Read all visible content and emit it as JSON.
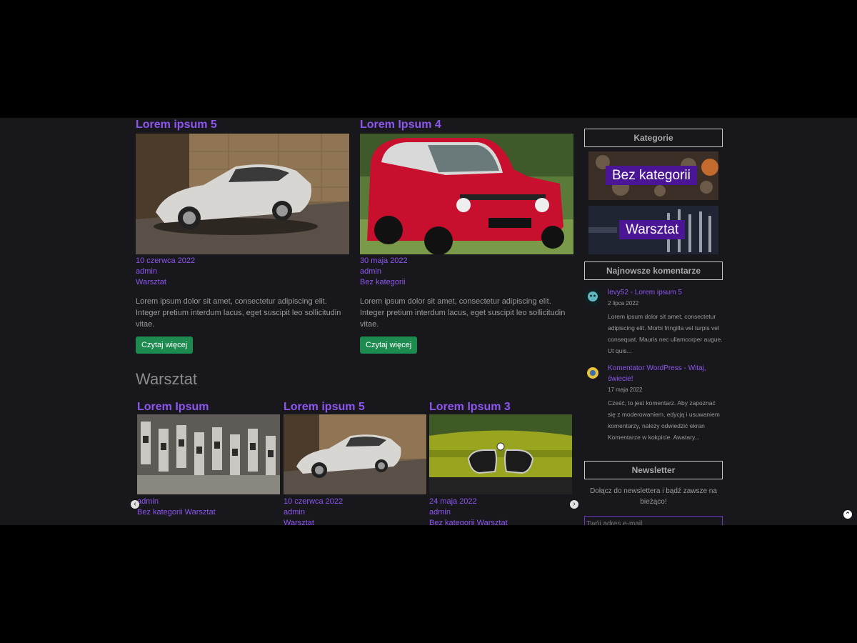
{
  "featured_posts": [
    {
      "title": "Lorem ipsum 5",
      "date": "10 czerwca 2022",
      "author": "admin",
      "category": "Warsztat",
      "excerpt": "Lorem ipsum dolor sit amet, consectetur adipiscing elit. Integer pretium interdum lacus, eget suscipit leo sollicitudin vitae.",
      "button": "Czytaj więcej",
      "image_icon": "white-sports-car-image"
    },
    {
      "title": "Lorem Ipsum 4",
      "date": "30 maja 2022",
      "author": "admin",
      "category": "Bez kategorii",
      "excerpt": "Lorem ipsum dolor sit amet, consectetur adipiscing elit. Integer pretium interdum lacus, eget suscipit leo sollicitudin vitae.",
      "button": "Czytaj więcej",
      "image_icon": "red-small-car-image"
    }
  ],
  "section": {
    "heading": "Warsztat",
    "cards": [
      {
        "title": "Lorem Ipsum",
        "meta1": "admin",
        "meta2": "Bez kategorii Warsztat",
        "meta3": "",
        "image_icon": "engine-valves-image"
      },
      {
        "title": "Lorem ipsum 5",
        "meta1": "10 czerwca 2022",
        "meta2": "admin",
        "meta3": "Warsztat",
        "image_icon": "white-sports-car-image"
      },
      {
        "title": "Lorem Ipsum 3",
        "meta1": "24 maja 2022",
        "meta2": "admin",
        "meta3": "Bez kategorii Warsztat",
        "image_icon": "green-bmw-image"
      }
    ],
    "prev_icon": "chevron-left-icon",
    "next_icon": "chevron-right-icon"
  },
  "sidebar": {
    "categories_title": "Kategorie",
    "categories": [
      "Bez kategorii",
      "Warsztat"
    ],
    "comments_title": "Najnowsze komentarze",
    "comments": [
      {
        "head": "levy52 - Lorem ipsum 5",
        "date": "2 lipca 2022",
        "text": "Lorem ipsum dolor sit amet, consectetur adipiscing elit. Morbi fringilla vel turpis vel consequat. Mauris nec ullamcorper augue. Ut quis..."
      },
      {
        "head": "Komentator WordPress - Witaj, świecie!",
        "date": "17 maja 2022",
        "text": "Cześć, to jest komentarz. Aby zapoznać się z moderowaniem, edycją i usuwaniem komentarzy, należy odwiedzić ekran Komentarze w kokpicie. Awatary..."
      }
    ],
    "newsletter_title": "Newsletter",
    "newsletter_text": "Dołącz do newslettera i bądź zawsze na bieżąco!",
    "newsletter_placeholder": "Twój adres e-mail"
  },
  "colors": {
    "accent": "#8d56f0",
    "button": "#1d8a4f",
    "background": "#18171b",
    "category_label": "#4b1696"
  }
}
